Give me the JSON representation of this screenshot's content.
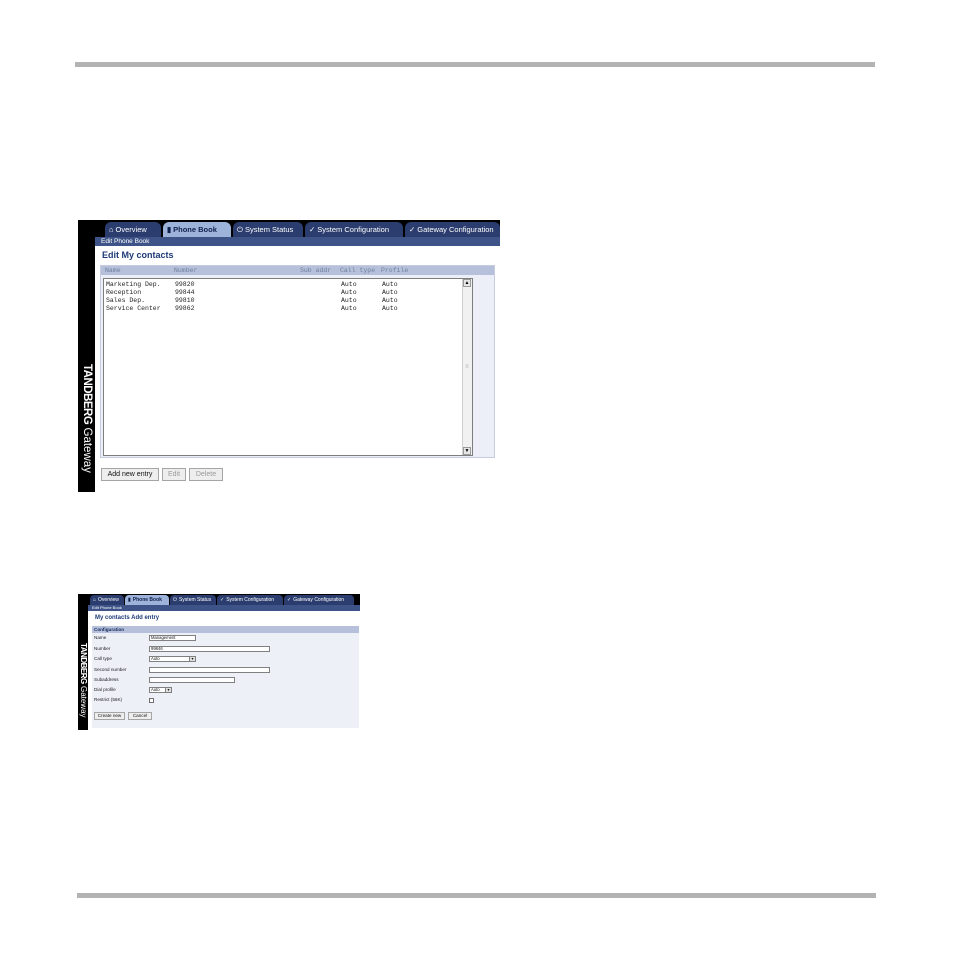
{
  "shot1": {
    "side_brand": "TANDBERG",
    "side_product": "Gateway",
    "tabs": [
      {
        "icon": "home-icon",
        "glyph": "⌂",
        "label": "Overview"
      },
      {
        "icon": "book-icon",
        "glyph": "▮",
        "label": "Phone Book"
      },
      {
        "icon": "power-icon",
        "glyph": "⏻",
        "label": "System Status"
      },
      {
        "icon": "wrench-icon",
        "glyph": "✓",
        "label": "System Configuration"
      },
      {
        "icon": "wrench-icon",
        "glyph": "✓",
        "label": "Gateway Configuration"
      }
    ],
    "breadcrumb": "Edit Phone Book",
    "heading": "Edit My contacts",
    "columns": [
      "Name",
      "Number",
      "Sub addr",
      "Call type",
      "Profile"
    ],
    "rows": [
      [
        "Marketing Dep.",
        "99820",
        "",
        "Auto",
        "Auto"
      ],
      [
        "Reception",
        "99844",
        "",
        "Auto",
        "Auto"
      ],
      [
        "Sales Dep.",
        "99810",
        "",
        "Auto",
        "Auto"
      ],
      [
        "Service Center",
        "99862",
        "",
        "Auto",
        "Auto"
      ]
    ],
    "buttons": {
      "add": "Add new entry",
      "edit": "Edit",
      "delete": "Delete"
    }
  },
  "shot2": {
    "side_brand": "TANDBERG",
    "side_product": "Gateway",
    "tabs": [
      {
        "icon": "home-icon",
        "glyph": "⌂",
        "label": "Overview"
      },
      {
        "icon": "book-icon",
        "glyph": "▮",
        "label": "Phone Book"
      },
      {
        "icon": "power-icon",
        "glyph": "⏻",
        "label": "System Status"
      },
      {
        "icon": "wrench-icon",
        "glyph": "✓",
        "label": "System Configuration"
      },
      {
        "icon": "wrench-icon",
        "glyph": "✓",
        "label": "Gateway Configuration"
      }
    ],
    "breadcrumb": "Edit Phone Book",
    "heading": "My contacts Add entry",
    "section": "Configuration",
    "fields": {
      "name": {
        "label": "Name",
        "value": "Management"
      },
      "number": {
        "label": "Number",
        "value": "99846"
      },
      "call_type": {
        "label": "Call type",
        "value": "Auto"
      },
      "second_number": {
        "label": "Second number",
        "value": ""
      },
      "subaddress": {
        "label": "Subaddress",
        "value": ""
      },
      "dial_profile": {
        "label": "Dial profile",
        "value": "Auto"
      },
      "restrict": {
        "label": "Restrict (56K)",
        "checked": false
      }
    },
    "buttons": {
      "create": "Create new",
      "cancel": "Cancel"
    }
  }
}
